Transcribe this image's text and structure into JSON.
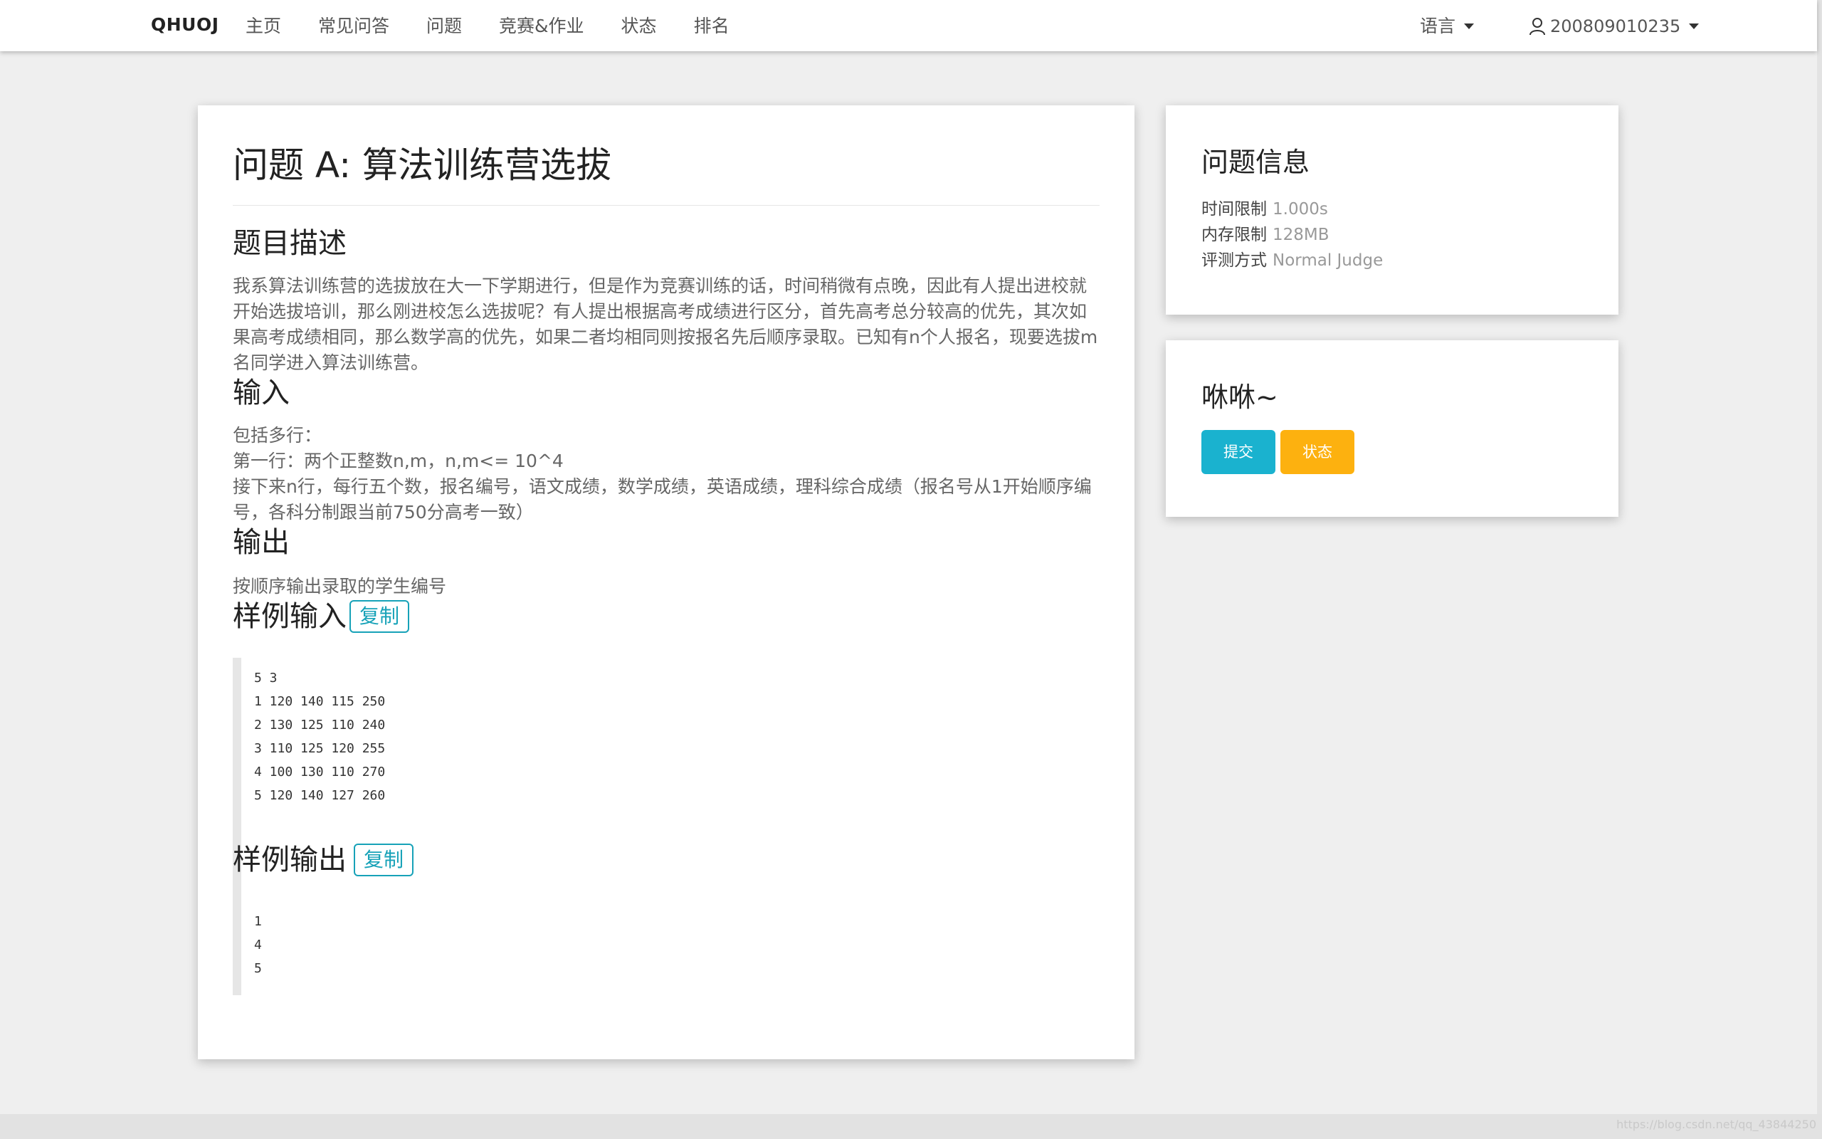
{
  "nav": {
    "brand": "QHUOJ",
    "items": [
      "主页",
      "常见问答",
      "问题",
      "竞赛&作业",
      "状态",
      "排名"
    ],
    "language": "语言",
    "username": "200809010235"
  },
  "problem": {
    "title": "问题 A: 算法训练营选拔",
    "desc_heading": "题目描述",
    "description": "我系算法训练营的选拔放在大一下学期进行，但是作为竞赛训练的话，时间稍微有点晚，因此有人提出进校就开始选拔培训，那么刚进校怎么选拔呢？有人提出根据高考成绩进行区分，首先高考总分较高的优先，其次如果高考成绩相同，那么数学高的优先，如果二者均相同则按报名先后顺序录取。已知有n个人报名，现要选拔m名同学进入算法训练营。",
    "input_heading": "输入",
    "input_lines": [
      "包括多行：",
      "第一行：两个正整数n,m，n,m<= 10^4",
      "接下来n行，每行五个数，报名编号，语文成绩，数学成绩，英语成绩，理科综合成绩（报名号从1开始顺序编号，各科分制跟当前750分高考一致）"
    ],
    "output_heading": "输出",
    "output_text": "按顺序输出录取的学生编号",
    "sample_input_heading": "样例输入",
    "sample_output_heading": "样例输出",
    "copy_label": "复制",
    "sample_input": "5 3\n1 120 140 115 250\n2 130 125 110 240\n3 110 125 120 255\n4 100 130 110 270\n5 120 140 127 260",
    "sample_output": "1\n4\n5"
  },
  "info": {
    "heading": "问题信息",
    "time_label": "时间限制",
    "time_value": "1.000s",
    "memory_label": "内存限制",
    "memory_value": "128MB",
    "judge_label": "评测方式",
    "judge_value": "Normal Judge"
  },
  "actions": {
    "heading": "咻咻~",
    "submit_label": "提交",
    "status_label": "状态"
  },
  "watermark": "https://blog.csdn.net/qq_43844250",
  "colors": {
    "submit": "#1ab2cf",
    "status": "#fdb10f",
    "copy": "#17a2b8"
  }
}
